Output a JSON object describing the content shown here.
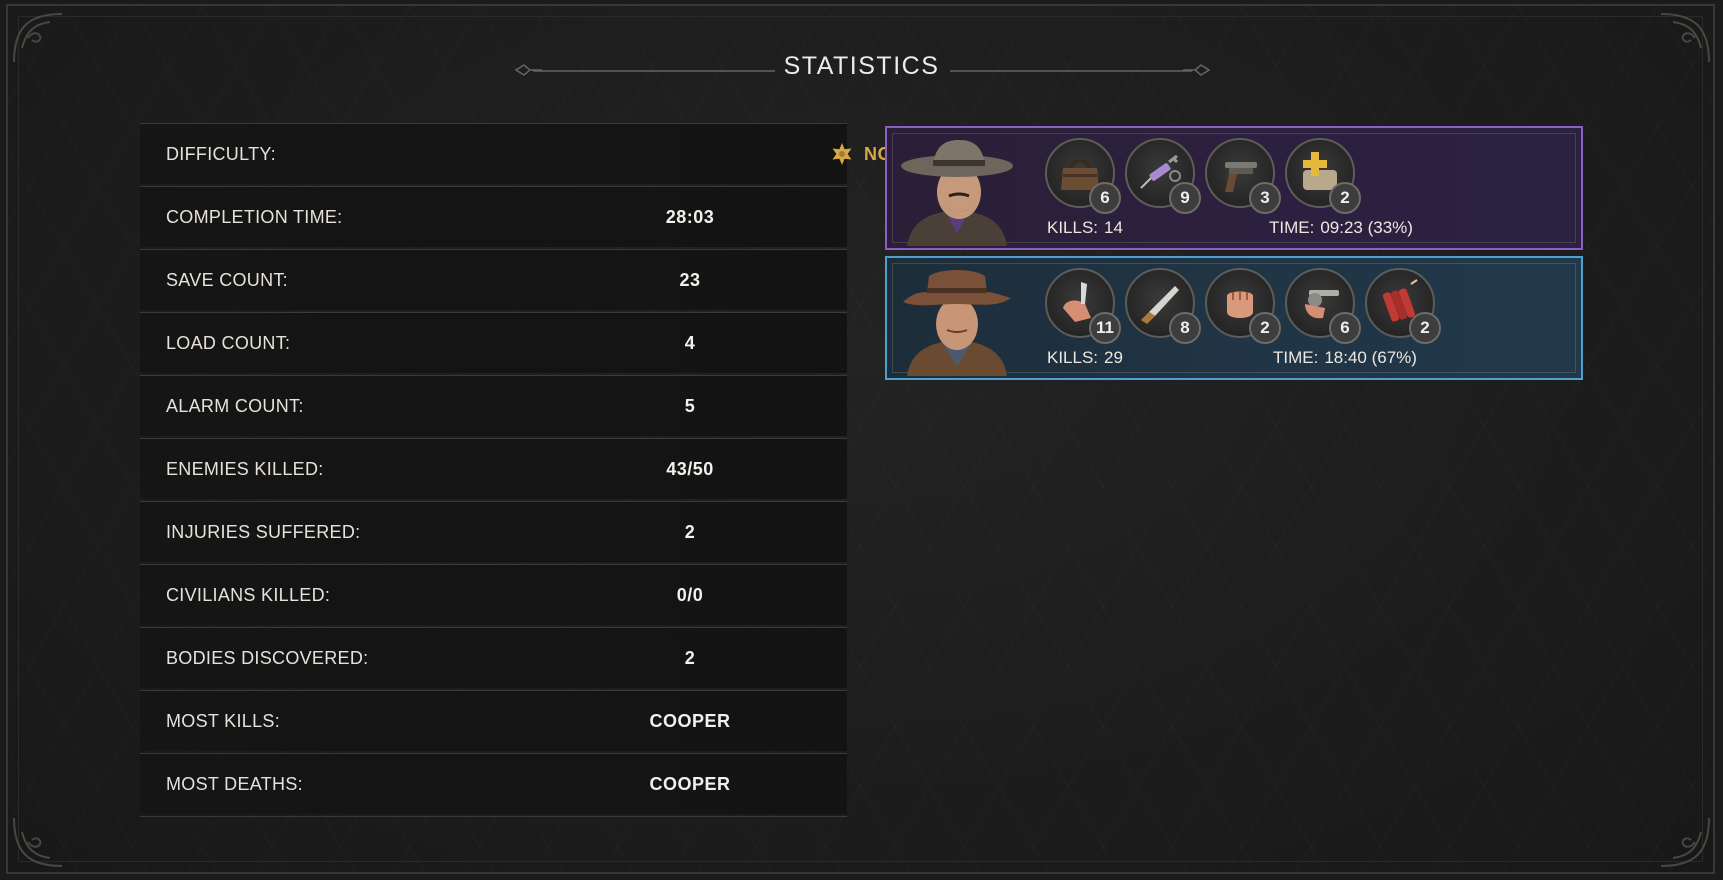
{
  "title": "STATISTICS",
  "difficulty": {
    "label": "DIFFICULTY:",
    "value": "NORMAL",
    "icon": "sheriff-star-icon",
    "color": "#d7a849"
  },
  "stats": [
    {
      "label": "COMPLETION TIME:",
      "value": "28:03"
    },
    {
      "label": "SAVE COUNT:",
      "value": "23"
    },
    {
      "label": "LOAD COUNT:",
      "value": "4"
    },
    {
      "label": "ALARM COUNT:",
      "value": "5"
    },
    {
      "label": "ENEMIES KILLED:",
      "value": "43/50"
    },
    {
      "label": "INJURIES SUFFERED:",
      "value": "2"
    },
    {
      "label": "CIVILIANS KILLED:",
      "value": "0/0"
    },
    {
      "label": "BODIES DISCOVERED:",
      "value": "2"
    },
    {
      "label": "MOST KILLS:",
      "value": "COOPER"
    },
    {
      "label": "MOST DEATHS:",
      "value": "COOPER"
    }
  ],
  "characters": [
    {
      "accent": "#8c5fc1",
      "items": [
        {
          "icon": "doctor-bag-icon",
          "count": "6"
        },
        {
          "icon": "syringe-icon",
          "count": "9"
        },
        {
          "icon": "scoped-pistol-icon",
          "count": "3"
        },
        {
          "icon": "bandage-plus-icon",
          "count": "2"
        }
      ],
      "kills_label": "KILLS:",
      "kills": "14",
      "time_label": "TIME:",
      "time": "09:23 (33%)"
    },
    {
      "accent": "#4f9fd0",
      "items": [
        {
          "icon": "knife-stab-icon",
          "count": "11"
        },
        {
          "icon": "throwing-knife-icon",
          "count": "8"
        },
        {
          "icon": "fist-icon",
          "count": "2"
        },
        {
          "icon": "revolver-icon",
          "count": "6"
        },
        {
          "icon": "dynamite-icon",
          "count": "2"
        }
      ],
      "kills_label": "KILLS:",
      "kills": "29",
      "time_label": "TIME:",
      "time": "18:40 (67%)"
    }
  ]
}
